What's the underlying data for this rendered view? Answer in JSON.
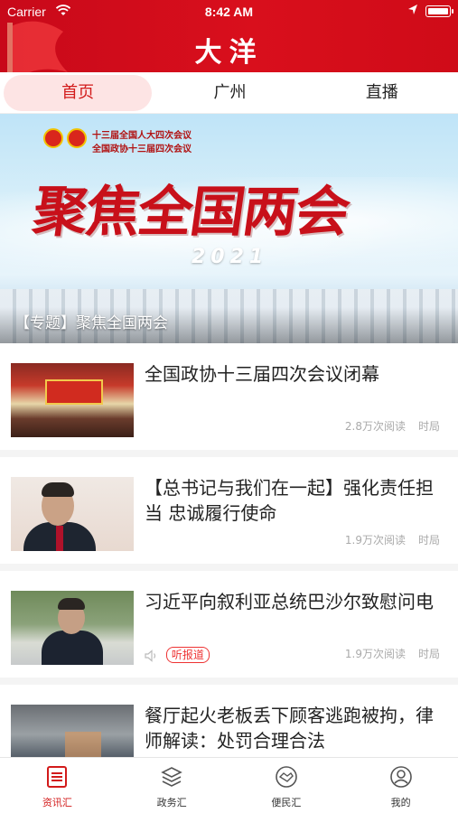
{
  "status_bar": {
    "carrier": "Carrier",
    "time": "8:42 AM",
    "battery_level": 0.9
  },
  "header": {
    "title": "大洋"
  },
  "tabs": [
    {
      "label": "首页",
      "active": true
    },
    {
      "label": "广州",
      "active": false
    },
    {
      "label": "直播",
      "active": false
    }
  ],
  "banner": {
    "line1": "十三届全国人大四次会议",
    "line2": "全国政协十三届四次会议",
    "headline": "聚焦全国两会",
    "year": "2021",
    "caption": "【专题】聚焦全国两会"
  },
  "news": [
    {
      "title": "全国政协十三届四次会议闭幕",
      "reads": "2.8万次阅读",
      "category": "时局",
      "listen": false
    },
    {
      "title": "【总书记与我们在一起】强化责任担当 忠诚履行使命",
      "reads": "1.9万次阅读",
      "category": "时局",
      "listen": false
    },
    {
      "title": "习近平向叙利亚总统巴沙尔致慰问电",
      "reads": "1.9万次阅读",
      "category": "时局",
      "listen": true,
      "listen_label": "听报道"
    },
    {
      "title": "餐厅起火老板丢下顾客逃跑被拘，律师解读：处罚合理合法",
      "reads": "",
      "category": "",
      "listen": false
    }
  ],
  "bottom_nav": [
    {
      "label": "资讯汇",
      "icon": "news-icon",
      "active": true
    },
    {
      "label": "政务汇",
      "icon": "layers-icon",
      "active": false
    },
    {
      "label": "便民汇",
      "icon": "handshake-icon",
      "active": false
    },
    {
      "label": "我的",
      "icon": "profile-icon",
      "active": false
    }
  ],
  "colors": {
    "brand_red": "#d21a1a",
    "tab_active_bg": "#fde4e4"
  }
}
